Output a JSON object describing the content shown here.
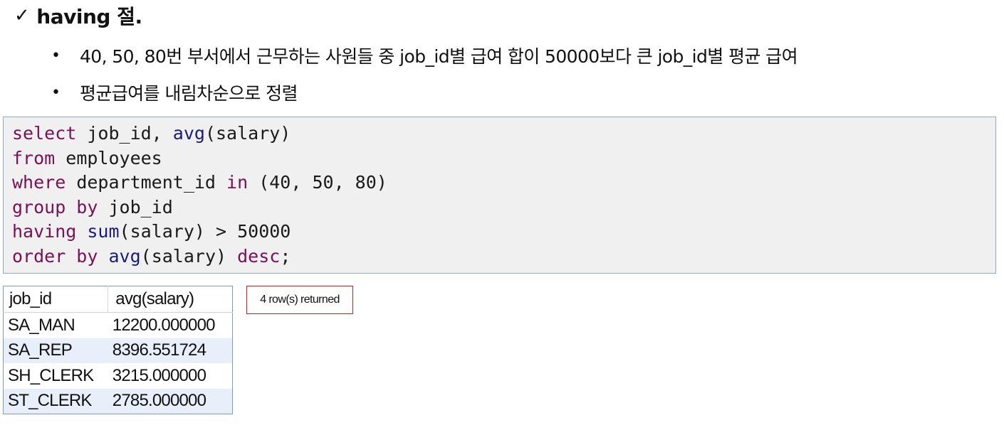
{
  "heading": {
    "check": "✓",
    "title": "having 절."
  },
  "bullets": [
    "40, 50, 80번 부서에서 근무하는 사원들 중 job_id별 급여 합이 50000보다 큰 job_id별 평균 급여",
    "평균급여를 내림차순으로 정렬"
  ],
  "sql": [
    [
      {
        "t": "select",
        "c": "kw"
      },
      {
        "t": " job_id, "
      },
      {
        "t": "avg",
        "c": "fn"
      },
      {
        "t": "(salary)"
      }
    ],
    [
      {
        "t": "from",
        "c": "kw"
      },
      {
        "t": " employees"
      }
    ],
    [
      {
        "t": "where",
        "c": "kw"
      },
      {
        "t": " department_id "
      },
      {
        "t": "in",
        "c": "kw"
      },
      {
        "t": " (40, 50, 80)"
      }
    ],
    [
      {
        "t": "group by",
        "c": "kw"
      },
      {
        "t": " job_id"
      }
    ],
    [
      {
        "t": "having",
        "c": "kw"
      },
      {
        "t": " "
      },
      {
        "t": "sum",
        "c": "fn"
      },
      {
        "t": "(salary) > 50000"
      }
    ],
    [
      {
        "t": "order by",
        "c": "kw"
      },
      {
        "t": " "
      },
      {
        "t": "avg",
        "c": "fn"
      },
      {
        "t": "(salary) "
      },
      {
        "t": "desc",
        "c": "kw"
      },
      {
        "t": ";"
      }
    ]
  ],
  "result": {
    "columns": [
      "job_id",
      "avg(salary)"
    ],
    "rows": [
      [
        "SA_MAN",
        "12200.000000"
      ],
      [
        "SA_REP",
        "8396.551724"
      ],
      [
        "SH_CLERK",
        "3215.000000"
      ],
      [
        "ST_CLERK",
        "2785.000000"
      ]
    ]
  },
  "rows_returned": "4 row(s) returned",
  "colors": {
    "keyword": "#7a1155",
    "function": "#1b1b7a",
    "badge_border": "#d02020",
    "row_alt": "#e8eefa"
  }
}
